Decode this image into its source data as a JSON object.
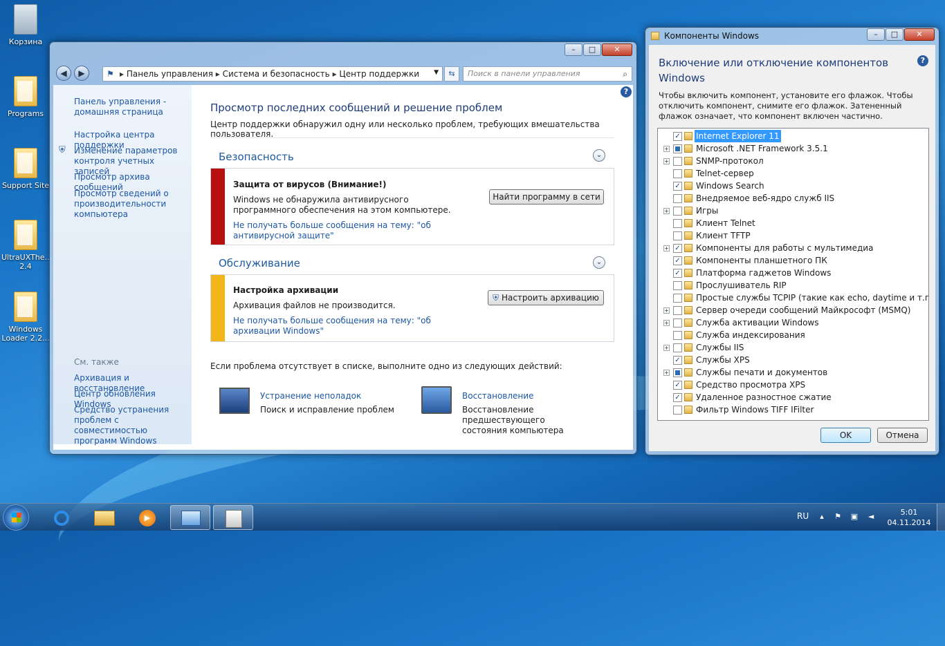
{
  "desktop": {
    "icons": [
      {
        "label": "Корзина"
      },
      {
        "label": "Programs"
      },
      {
        "label": "Support Site"
      },
      {
        "label": "UltraUXThe... 2.4"
      },
      {
        "label": "Windows Loader 2.2..."
      }
    ]
  },
  "control_panel": {
    "breadcrumb": [
      "Панель управления",
      "Система и безопасность",
      "Центр поддержки"
    ],
    "search_placeholder": "Поиск в панели управления",
    "left_nav": [
      "Панель управления - домашняя страница",
      "Настройка центра поддержки",
      "Изменение параметров контроля учетных записей",
      "Просмотр архива сообщений",
      "Просмотр сведений о производительности компьютера"
    ],
    "see_also_title": "См. также",
    "see_also": [
      "Архивация и восстановление",
      "Центр обновления Windows",
      "Средство устранения проблем с совместимостью программ Windows"
    ],
    "title": "Просмотр последних сообщений и решение проблем",
    "subtitle": "Центр поддержки обнаружил одну или несколько проблем, требующих вмешательства пользователя.",
    "security": {
      "heading": "Безопасность",
      "item_title": "Защита от вирусов  (Внимание!)",
      "item_text": "Windows не обнаружила антивирусного программного обеспечения на этом компьютере.",
      "item_link": "Не получать больше сообщения на тему: \"об антивирусной защите\"",
      "button": "Найти программу в сети",
      "color": "#b80f0f"
    },
    "maintenance": {
      "heading": "Обслуживание",
      "item_title": "Настройка архивации",
      "item_text": "Архивация файлов не производится.",
      "item_link": "Не получать больше сообщения на тему: \"об архивации Windows\"",
      "button": "Настроить архивацию",
      "color": "#f2b51a"
    },
    "footer_text": "Если проблема отсутствует в списке, выполните одно из следующих действий:",
    "troubleshoot": {
      "title": "Устранение неполадок",
      "desc": "Поиск и исправление проблем"
    },
    "recovery": {
      "title": "Восстановление",
      "desc": "Восстановление предшествующего состояния компьютера"
    }
  },
  "features": {
    "window_title": "Компоненты Windows",
    "heading": "Включение или отключение компонентов Windows",
    "description": "Чтобы включить компонент, установите его флажок. Чтобы отключить компонент, снимите его флажок. Затененный флажок означает, что компонент включен частично.",
    "items": [
      {
        "label": "Internet Explorer 11",
        "state": "checked",
        "expand": false,
        "selected": true
      },
      {
        "label": "Microsoft .NET Framework 3.5.1",
        "state": "partial",
        "expand": true
      },
      {
        "label": "SNMP-протокол",
        "state": "unchecked",
        "expand": true
      },
      {
        "label": "Telnet-сервер",
        "state": "unchecked",
        "expand": false
      },
      {
        "label": "Windows Search",
        "state": "checked",
        "expand": false
      },
      {
        "label": "Внедряемое веб-ядро служб IIS",
        "state": "unchecked",
        "expand": false
      },
      {
        "label": "Игры",
        "state": "unchecked",
        "expand": true
      },
      {
        "label": "Клиент Telnet",
        "state": "unchecked",
        "expand": false
      },
      {
        "label": "Клиент TFTP",
        "state": "unchecked",
        "expand": false
      },
      {
        "label": "Компоненты для работы с мультимедиа",
        "state": "checked",
        "expand": true
      },
      {
        "label": "Компоненты планшетного ПК",
        "state": "checked",
        "expand": false
      },
      {
        "label": "Платформа гаджетов Windows",
        "state": "checked",
        "expand": false
      },
      {
        "label": "Прослушиватель RIP",
        "state": "unchecked",
        "expand": false
      },
      {
        "label": "Простые службы TCPIP (такие как echo, daytime и т.п.)",
        "state": "unchecked",
        "expand": false
      },
      {
        "label": "Сервер очереди сообщений Майкрософт (MSMQ)",
        "state": "unchecked",
        "expand": true
      },
      {
        "label": "Служба активации Windows",
        "state": "unchecked",
        "expand": true
      },
      {
        "label": "Служба индексирования",
        "state": "unchecked",
        "expand": false
      },
      {
        "label": "Службы IIS",
        "state": "unchecked",
        "expand": true
      },
      {
        "label": "Службы XPS",
        "state": "checked",
        "expand": false
      },
      {
        "label": "Службы печати и документов",
        "state": "partial",
        "expand": true
      },
      {
        "label": "Средство просмотра XPS",
        "state": "checked",
        "expand": false
      },
      {
        "label": "Удаленное разностное сжатие",
        "state": "checked",
        "expand": false
      },
      {
        "label": "Фильтр Windows TIFF IFilter",
        "state": "unchecked",
        "expand": false
      }
    ],
    "ok": "OK",
    "cancel": "Отмена"
  },
  "taskbar": {
    "lang": "RU",
    "time": "5:01",
    "date": "04.11.2014"
  }
}
